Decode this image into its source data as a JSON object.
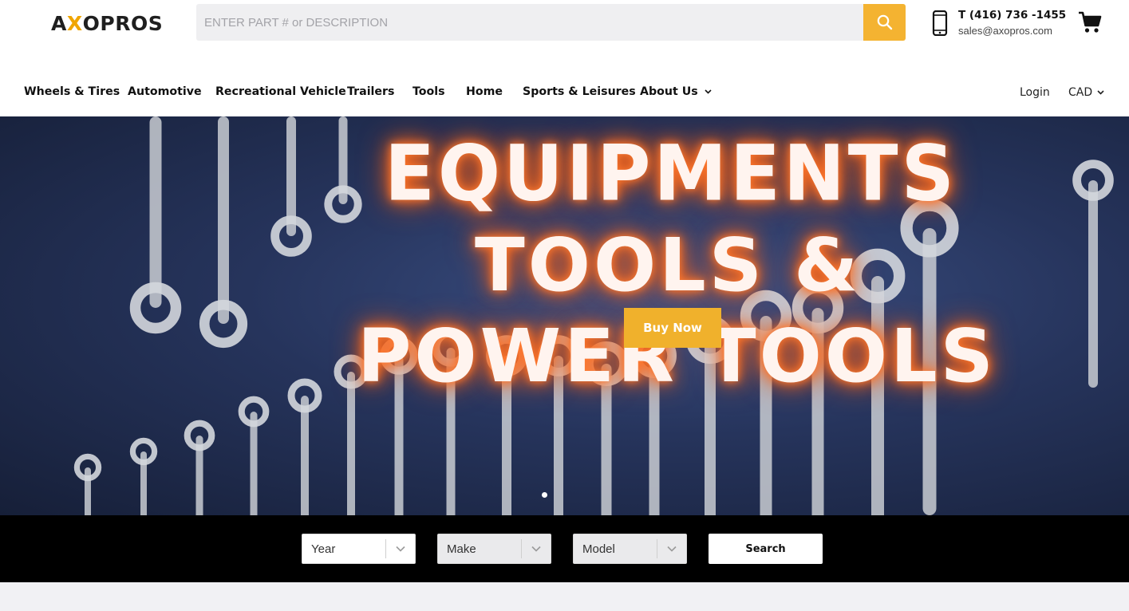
{
  "brand": {
    "logo_prefix": "A",
    "logo_mark": "X",
    "logo_suffix": "OPROS",
    "accent_color": "#f4b331"
  },
  "search": {
    "placeholder": "ENTER PART # or DESCRIPTION",
    "value": "",
    "button_icon": "search-icon"
  },
  "contact": {
    "phone": "T (416) 736 -1455",
    "email": "sales@axopros.com",
    "icon": "mobile-phone-icon"
  },
  "cart": {
    "icon": "shopping-cart-icon"
  },
  "nav": {
    "items": [
      {
        "label": "Wheels & Tires"
      },
      {
        "label": "Automotive"
      },
      {
        "label": "Recreational Vehicle"
      },
      {
        "label": "Trailers"
      },
      {
        "label": "Tools"
      },
      {
        "label": "Home"
      },
      {
        "label": "Sports & Leisures"
      },
      {
        "label": "About Us",
        "dropdown": true
      }
    ],
    "login": "Login",
    "currency": "CAD"
  },
  "hero": {
    "headline": [
      "EQUIPMENTS",
      "TOOLS &",
      "POWER TOOLS"
    ],
    "cta": "Buy Now",
    "cta_color": "#f0b12c",
    "slides_total": 1,
    "active_slide": 1
  },
  "vehicle_search": {
    "year": "Year",
    "make": "Make",
    "model": "Model",
    "button": "Search"
  }
}
